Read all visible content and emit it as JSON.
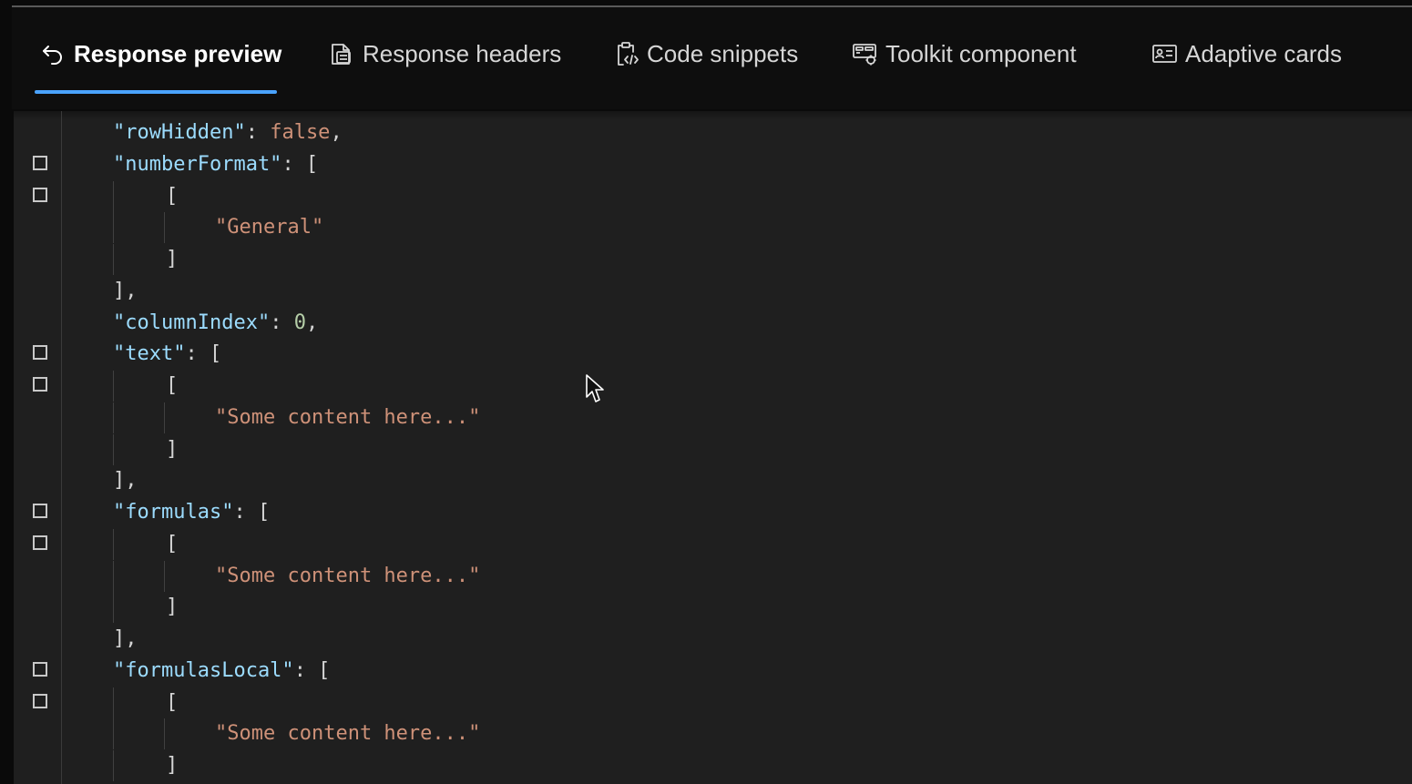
{
  "tabs": [
    {
      "label": "Response preview",
      "icon": "undo-arrow-icon",
      "active": true
    },
    {
      "label": "Response headers",
      "icon": "document-list-icon",
      "active": false
    },
    {
      "label": "Code snippets",
      "icon": "clipboard-code-icon",
      "active": false
    },
    {
      "label": "Toolkit component",
      "icon": "component-gear-icon",
      "active": false
    },
    {
      "label": "Adaptive cards",
      "icon": "contact-card-icon",
      "active": false
    }
  ],
  "colors": {
    "accent": "#4aa3ff",
    "json_key": "#9cdcfe",
    "json_string": "#ce9178",
    "json_number": "#b5cea8",
    "editor_background": "#1f1f1f"
  },
  "json_lines": [
    {
      "parts": [
        {
          "t": "\"rowHidden\"",
          "c": "key"
        },
        {
          "t": ": ",
          "c": "punc"
        },
        {
          "t": "false",
          "c": "bool"
        },
        {
          "t": ",",
          "c": "punc"
        }
      ]
    },
    {
      "parts": [
        {
          "t": "\"numberFormat\"",
          "c": "key"
        },
        {
          "t": ": [",
          "c": "punc"
        }
      ]
    },
    {
      "parts": [
        {
          "t": "[",
          "c": "punc"
        }
      ]
    },
    {
      "parts": [
        {
          "t": "\"General\"",
          "c": "str"
        }
      ]
    },
    {
      "parts": [
        {
          "t": "]",
          "c": "punc"
        }
      ]
    },
    {
      "parts": [
        {
          "t": "],",
          "c": "punc"
        }
      ]
    },
    {
      "parts": [
        {
          "t": "\"columnIndex\"",
          "c": "key"
        },
        {
          "t": ": ",
          "c": "punc"
        },
        {
          "t": "0",
          "c": "num"
        },
        {
          "t": ",",
          "c": "punc"
        }
      ]
    },
    {
      "parts": [
        {
          "t": "\"text\"",
          "c": "key"
        },
        {
          "t": ": [",
          "c": "punc"
        }
      ]
    },
    {
      "parts": [
        {
          "t": "[",
          "c": "punc"
        }
      ]
    },
    {
      "parts": [
        {
          "t": "\"Some content here...\"",
          "c": "str"
        }
      ]
    },
    {
      "parts": [
        {
          "t": "]",
          "c": "punc"
        }
      ]
    },
    {
      "parts": [
        {
          "t": "],",
          "c": "punc"
        }
      ]
    },
    {
      "parts": [
        {
          "t": "\"formulas\"",
          "c": "key"
        },
        {
          "t": ": [",
          "c": "punc"
        }
      ]
    },
    {
      "parts": [
        {
          "t": "[",
          "c": "punc"
        }
      ]
    },
    {
      "parts": [
        {
          "t": "\"Some content here...\"",
          "c": "str"
        }
      ]
    },
    {
      "parts": [
        {
          "t": "]",
          "c": "punc"
        }
      ]
    },
    {
      "parts": [
        {
          "t": "],",
          "c": "punc"
        }
      ]
    },
    {
      "parts": [
        {
          "t": "\"formulasLocal\"",
          "c": "key"
        },
        {
          "t": ": [",
          "c": "punc"
        }
      ]
    },
    {
      "parts": [
        {
          "t": "[",
          "c": "punc"
        }
      ]
    },
    {
      "parts": [
        {
          "t": "\"Some content here...\"",
          "c": "str"
        }
      ]
    },
    {
      "parts": [
        {
          "t": "]",
          "c": "punc"
        }
      ]
    }
  ]
}
